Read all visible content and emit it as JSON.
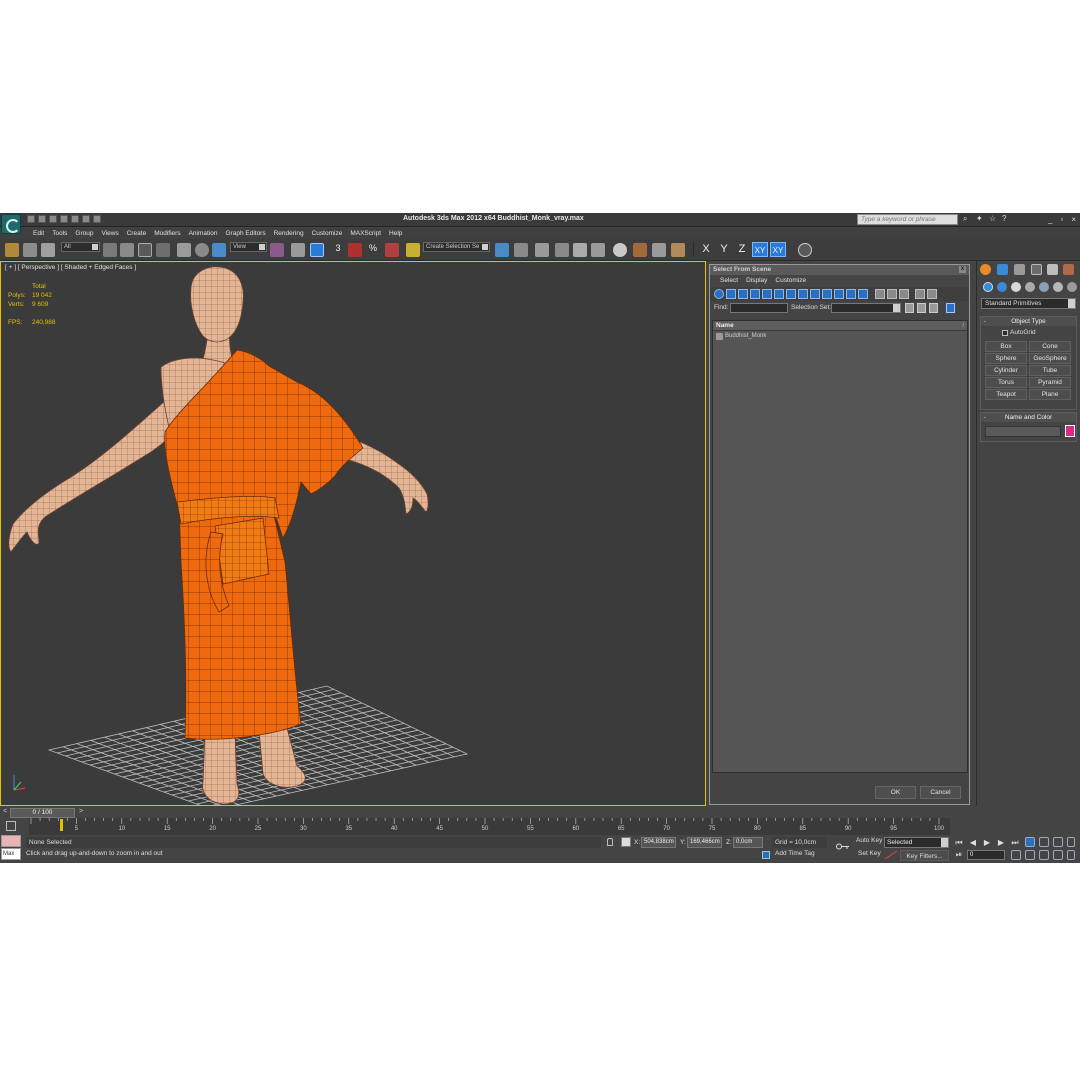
{
  "app": {
    "title": "Autodesk 3ds Max  2012 x64     Buddhist_Monk_vray.max",
    "help_search_placeholder": "Type a keyword or phrase",
    "menus": [
      "Edit",
      "Tools",
      "Group",
      "Views",
      "Create",
      "Modifiers",
      "Animation",
      "Graph Editors",
      "Rendering",
      "Customize",
      "MAXScript",
      "Help"
    ]
  },
  "toolbar": {
    "filter_value": "All",
    "ref_coord_value": "View",
    "selection_set_placeholder": "Create Selection Se",
    "axes": [
      "X",
      "Y",
      "Z",
      "XY",
      "XY"
    ],
    "snap_labels": [
      "3",
      "%"
    ]
  },
  "viewport": {
    "label": "[ + ] [ Perspective ] [ Shaded + Edged Faces ]",
    "stats_header": "Total",
    "stats": [
      {
        "key": "Polys:",
        "value": "19 042"
      },
      {
        "key": "Verts:",
        "value": "9 609"
      }
    ],
    "fps_key": "FPS:",
    "fps_value": "240,988",
    "colors": {
      "robe": "#ef6a0e",
      "skin": "#e7b89a",
      "wire": "#4a2a10",
      "grid": "#bdbdbd",
      "border": "#e6c300"
    }
  },
  "select_from_scene": {
    "title": "Select From Scene",
    "menus": [
      "Select",
      "Display",
      "Customize"
    ],
    "find_label": "Find:",
    "selection_set_label": "Selection Set:",
    "column_header": "Name",
    "objects": [
      "Buddhist_Monk"
    ],
    "ok_label": "OK",
    "cancel_label": "Cancel"
  },
  "command_panel": {
    "category": "Standard Primitives",
    "object_type_title": "Object Type",
    "autogrid_label": "AutoGrid",
    "primitives": [
      "Box",
      "Cone",
      "Sphere",
      "GeoSphere",
      "Cylinder",
      "Tube",
      "Torus",
      "Pyramid",
      "Teapot",
      "Plane"
    ],
    "name_color_title": "Name and Color",
    "object_color": "#d92b86"
  },
  "timeline": {
    "frame_label": "0 / 100",
    "ticks": [
      "5",
      "10",
      "15",
      "20",
      "25",
      "30",
      "35",
      "40",
      "45",
      "50",
      "55",
      "60",
      "65",
      "70",
      "75",
      "80",
      "85",
      "90",
      "95",
      "100"
    ]
  },
  "status": {
    "maxscript_label": "Max",
    "selection_text": "None Selected",
    "prompt_text": "Click and drag up-and-down to zoom in and out",
    "x_label": "X:",
    "x_value": "504,838cm",
    "y_label": "Y:",
    "y_value": "169,466cm",
    "z_label": "Z:",
    "z_value": "0,0cm",
    "grid_text": "Grid = 10,0cm",
    "auto_key_label": "Auto Key",
    "set_key_label": "Set Key",
    "key_mode_value": "Selected",
    "key_filters_label": "Key Filters...",
    "add_time_tag_label": "Add Time Tag",
    "frame_value": "0"
  }
}
